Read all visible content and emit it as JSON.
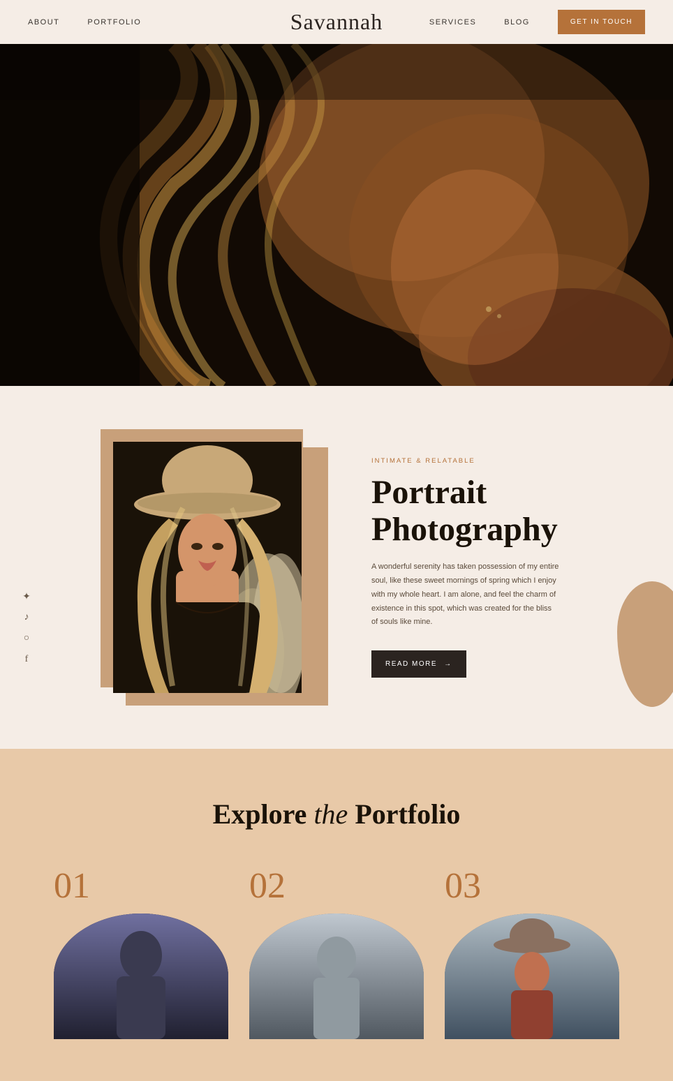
{
  "nav": {
    "brand": "Savannah",
    "links_left": [
      "About",
      "Portfolio"
    ],
    "links_right": [
      "Services",
      "Blog"
    ],
    "cta": "Get In Touch"
  },
  "portrait_section": {
    "subtitle": "Intimate & Relatable",
    "heading_line1": "Portrait",
    "heading_line2": "Photography",
    "body": "A wonderful serenity has taken possession of my entire soul, like these sweet mornings of spring which I enjoy with my whole heart. I am alone, and feel the charm of existence in this spot, which was created for the bliss of souls like mine.",
    "read_more": "Read More"
  },
  "portfolio_section": {
    "heading_normal": "Explore",
    "heading_italic": "the",
    "heading_normal2": "Portfolio",
    "items": [
      {
        "number": "01"
      },
      {
        "number": "02"
      },
      {
        "number": "03"
      }
    ]
  },
  "social": {
    "icons": [
      "pinterest",
      "tiktok",
      "instagram",
      "facebook"
    ]
  }
}
